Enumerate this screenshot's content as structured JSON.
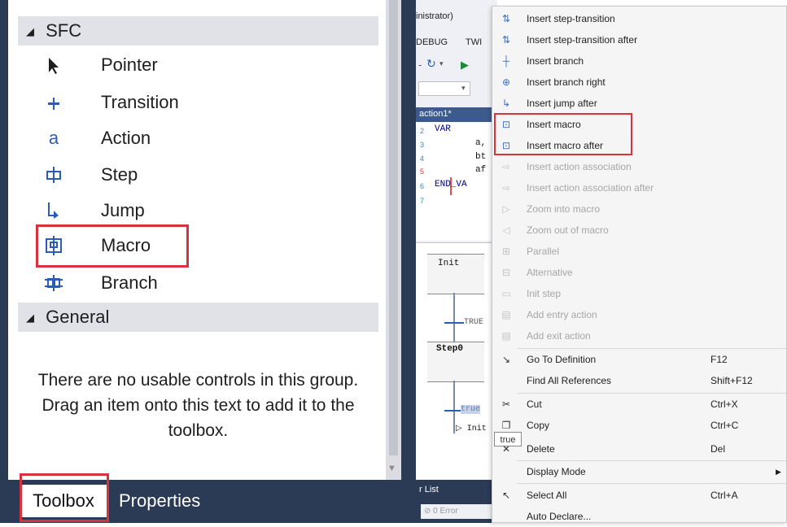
{
  "toolbox": {
    "sections": {
      "sfc": {
        "label": "SFC",
        "arrow": "◢"
      },
      "general": {
        "label": "General",
        "arrow": "◢"
      }
    },
    "items": [
      {
        "label": "Pointer",
        "icon": "pointer-icon",
        "glyph": "➤"
      },
      {
        "label": "Transition",
        "icon": "transition-icon",
        "glyph": "+"
      },
      {
        "label": "Action",
        "icon": "action-icon",
        "glyph": "a"
      },
      {
        "label": "Step",
        "icon": "step-icon",
        "glyph": "⊏⊐"
      },
      {
        "label": "Jump",
        "icon": "jump-icon",
        "glyph": "↳"
      },
      {
        "label": "Macro",
        "icon": "macro-icon",
        "glyph": "⊡"
      },
      {
        "label": "Branch",
        "icon": "branch-icon",
        "glyph": "⊞"
      }
    ],
    "empty_message": "There are no usable controls in this group. Drag an item onto this text to add it to the toolbox.",
    "tabs": {
      "toolbox": "Toolbox",
      "properties": "Properties"
    }
  },
  "ide": {
    "title_fragment": "inistrator)",
    "menu_fragments": [
      "DEBUG",
      "TWI"
    ],
    "code_tab": "action1*",
    "code_lines": [
      {
        "num": "2",
        "text": "VAR"
      },
      {
        "num": "3",
        "text": "a,"
      },
      {
        "num": "4",
        "text": "bt"
      },
      {
        "num": "5",
        "text": "af"
      },
      {
        "num": "6",
        "text": "END_VA"
      },
      {
        "num": "7",
        "text": ""
      }
    ],
    "sfc": {
      "init": "Init",
      "true1": "TRUE",
      "step0": "Step0",
      "true2": "true",
      "jump_init": "Init"
    },
    "error_list": {
      "title": "r List",
      "errors": "0 Error"
    }
  },
  "menu": {
    "items": [
      {
        "label": "Insert step-transition",
        "icon": "insert-step-transition-icon",
        "glyph": "⇅",
        "enabled": true
      },
      {
        "label": "Insert step-transition after",
        "icon": "insert-step-transition-after-icon",
        "glyph": "⇅",
        "enabled": true
      },
      {
        "label": "Insert branch",
        "icon": "insert-branch-icon",
        "glyph": "┼",
        "enabled": true
      },
      {
        "label": "Insert branch right",
        "icon": "insert-branch-right-icon",
        "glyph": "⊕",
        "enabled": true
      },
      {
        "label": "Insert jump after",
        "icon": "insert-jump-after-icon",
        "glyph": "↳",
        "enabled": true
      },
      {
        "label": "Insert macro",
        "icon": "insert-macro-icon",
        "glyph": "⊡",
        "enabled": true
      },
      {
        "label": "Insert macro after",
        "icon": "insert-macro-after-icon",
        "glyph": "⊡",
        "enabled": true
      },
      {
        "label": "Insert action association",
        "icon": "insert-action-association-icon",
        "glyph": "⇨",
        "enabled": false
      },
      {
        "label": "Insert action association after",
        "icon": "insert-action-association-after-icon",
        "glyph": "⇨",
        "enabled": false
      },
      {
        "label": "Zoom into macro",
        "icon": "zoom-into-macro-icon",
        "glyph": "▷",
        "enabled": false
      },
      {
        "label": "Zoom out of macro",
        "icon": "zoom-out-of-macro-icon",
        "glyph": "◁",
        "enabled": false
      },
      {
        "label": "Parallel",
        "icon": "parallel-icon",
        "glyph": "⊞",
        "enabled": false
      },
      {
        "label": "Alternative",
        "icon": "alternative-icon",
        "glyph": "⊟",
        "enabled": false
      },
      {
        "label": "Init step",
        "icon": "init-step-icon",
        "glyph": "▭",
        "enabled": false
      },
      {
        "label": "Add entry action",
        "icon": "add-entry-action-icon",
        "glyph": "▤",
        "enabled": false
      },
      {
        "label": "Add exit action",
        "icon": "add-exit-action-icon",
        "glyph": "▤",
        "enabled": false
      },
      {
        "label": "Go To Definition",
        "shortcut": "F12",
        "icon": "go-to-definition-icon",
        "glyph": "↘",
        "enabled": true
      },
      {
        "label": "Find All References",
        "shortcut": "Shift+F12",
        "icon": "find-references-icon",
        "glyph": "",
        "enabled": true
      },
      {
        "label": "Cut",
        "shortcut": "Ctrl+X",
        "icon": "scissors-icon",
        "glyph": "✂",
        "enabled": true
      },
      {
        "label": "Copy",
        "shortcut": "Ctrl+C",
        "icon": "copy-icon",
        "glyph": "❐",
        "enabled": true
      },
      {
        "label": "Delete",
        "shortcut": "Del",
        "icon": "delete-icon",
        "glyph": "✕",
        "enabled": true
      },
      {
        "label": "Display Mode",
        "icon": "display-mode-icon",
        "glyph": "",
        "submenu": "▶",
        "enabled": true
      },
      {
        "label": "Select All",
        "shortcut": "Ctrl+A",
        "icon": "select-all-icon",
        "glyph": "↖",
        "enabled": true
      },
      {
        "label": "Auto Declare...",
        "icon": "auto-declare-icon",
        "glyph": "",
        "enabled": true
      }
    ],
    "tooltip": "true"
  },
  "colors": {
    "highlight": "#d8333a",
    "frame": "#2b3a55",
    "icon_blue": "#2c5cb8"
  }
}
